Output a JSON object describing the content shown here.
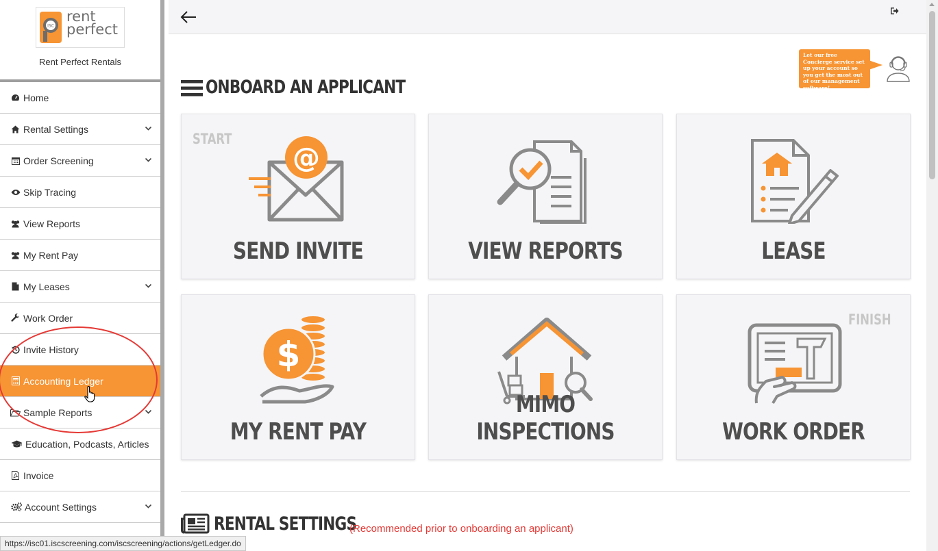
{
  "brand": {
    "logo_text_line1": "rent",
    "logo_text_line2": "perfect",
    "logo_badge_text": "ISC",
    "name": "Rent Perfect Rentals"
  },
  "sidebar": {
    "items": [
      {
        "label": "Home",
        "icon": "dashboard-icon",
        "has_submenu": false
      },
      {
        "label": "Rental Settings",
        "icon": "home-icon",
        "has_submenu": true
      },
      {
        "label": "Order Screening",
        "icon": "calendar-icon",
        "has_submenu": true
      },
      {
        "label": "Skip Tracing",
        "icon": "eye-icon",
        "has_submenu": false
      },
      {
        "label": "View Reports",
        "icon": "users-icon",
        "has_submenu": false
      },
      {
        "label": "My Rent Pay",
        "icon": "users-icon",
        "has_submenu": false
      },
      {
        "label": "My Leases",
        "icon": "file-icon",
        "has_submenu": true
      },
      {
        "label": "Work Order",
        "icon": "wrench-icon",
        "has_submenu": false
      },
      {
        "label": "Invite History",
        "icon": "history-icon",
        "has_submenu": false
      },
      {
        "label": "Accounting Ledger",
        "icon": "calculator-icon",
        "has_submenu": false,
        "active": true
      },
      {
        "label": "Sample Reports",
        "icon": "folder-open-icon",
        "has_submenu": true
      },
      {
        "label": "Education, Podcasts, Articles",
        "icon": "graduation-cap-icon",
        "has_submenu": false
      },
      {
        "label": "Invoice",
        "icon": "pdf-file-icon",
        "has_submenu": false
      },
      {
        "label": "Account Settings",
        "icon": "gears-icon",
        "has_submenu": true
      }
    ]
  },
  "status_bar": {
    "url": "https://isc01.iscscreening.com/iscscreening/actions/getLedger.do"
  },
  "concierge": {
    "text": "Let our free Concierge service set up your account so you get the most out of our management software!"
  },
  "onboard": {
    "title": "ONBOARD AN APPLICANT",
    "start_tag": "START",
    "finish_tag": "FINISH",
    "cards": [
      {
        "label": "SEND INVITE"
      },
      {
        "label": "VIEW REPORTS"
      },
      {
        "label": "LEASE"
      },
      {
        "label": "MY RENT PAY"
      },
      {
        "label": "MIMO INSPECTIONS"
      },
      {
        "label": "WORK ORDER"
      }
    ]
  },
  "rental_settings": {
    "title": "RENTAL SETTINGS",
    "note": "(Recommended prior to onboarding an applicant)"
  },
  "colors": {
    "accent": "#f79433",
    "icon_gray": "#7a7a7a",
    "alert_red": "#e53935"
  }
}
